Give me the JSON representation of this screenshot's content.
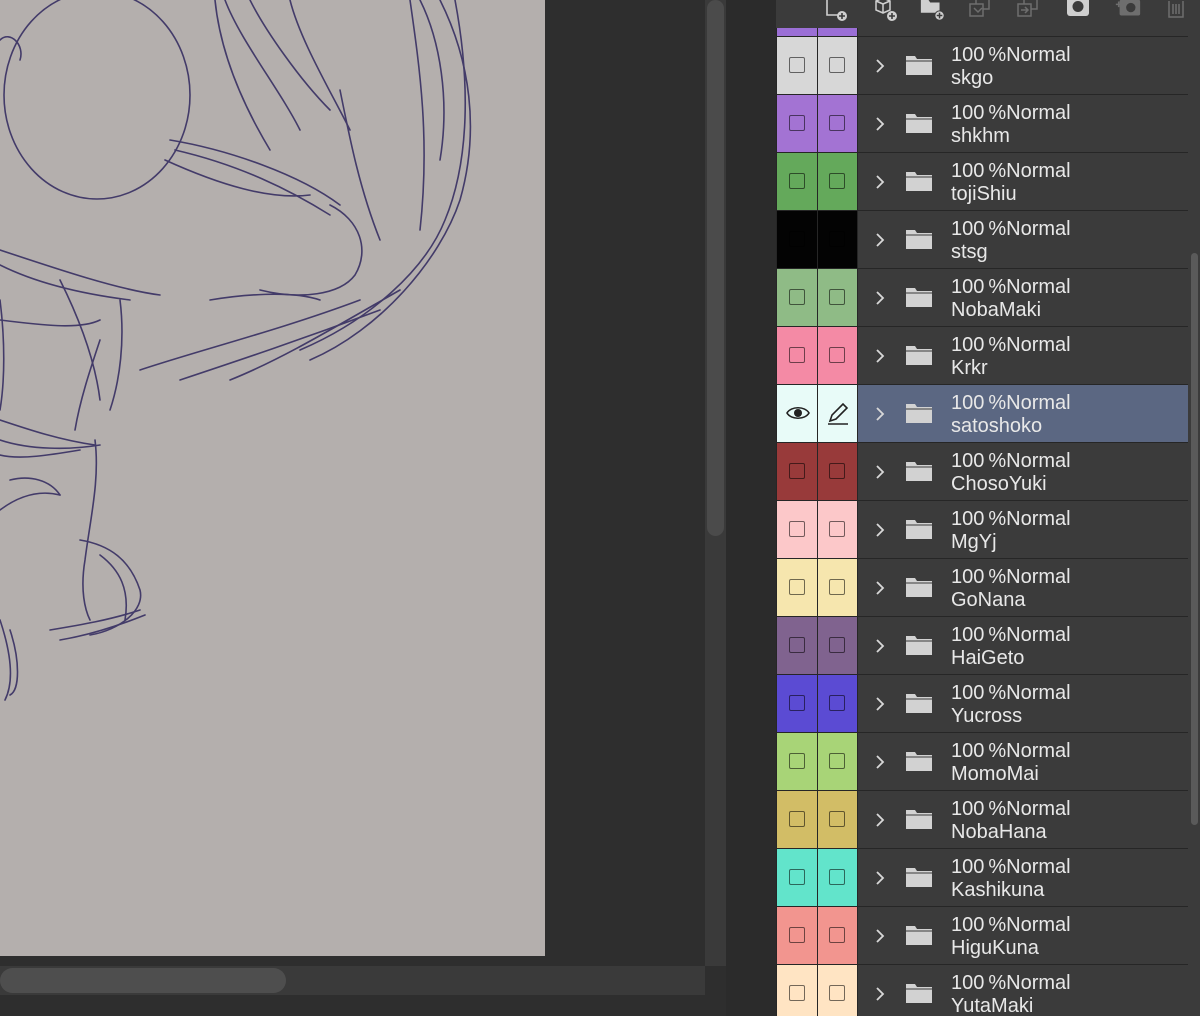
{
  "layer_panel": {
    "toolbar_icons": [
      "new-raster-layer-icon",
      "new-3d-layer-icon",
      "new-folder-icon",
      "transfer-to-lower-layer-icon",
      "combine-with-lower-layer-icon",
      "apply-mask-icon",
      "create-layer-mask-icon",
      "delete-layer-icon"
    ],
    "cut_top_color": "#9b6fd6",
    "layers": [
      {
        "opacity": "100",
        "unit": "%",
        "blend": "Normal",
        "name": "skgo",
        "color": "#d7d7d7",
        "selected": false
      },
      {
        "opacity": "100",
        "unit": "%",
        "blend": "Normal",
        "name": "shkhm",
        "color": "#a373d3",
        "selected": false
      },
      {
        "opacity": "100",
        "unit": "%",
        "blend": "Normal",
        "name": "tojiShiu",
        "color": "#64a95b",
        "selected": false
      },
      {
        "opacity": "100",
        "unit": "%",
        "blend": "Normal",
        "name": "stsg",
        "color": "#030303",
        "selected": false
      },
      {
        "opacity": "100",
        "unit": "%",
        "blend": "Normal",
        "name": "NobaMaki",
        "color": "#8fbb86",
        "selected": false
      },
      {
        "opacity": "100",
        "unit": "%",
        "blend": "Normal",
        "name": "Krkr",
        "color": "#f48aa5",
        "selected": false
      },
      {
        "opacity": "100",
        "unit": "%",
        "blend": "Normal",
        "name": "satoshoko",
        "color": "#e8fbf8",
        "selected": true
      },
      {
        "opacity": "100",
        "unit": "%",
        "blend": "Normal",
        "name": "ChosoYuki",
        "color": "#983a3a",
        "selected": false
      },
      {
        "opacity": "100",
        "unit": "%",
        "blend": "Normal",
        "name": "MgYj",
        "color": "#fcc8c9",
        "selected": false
      },
      {
        "opacity": "100",
        "unit": "%",
        "blend": "Normal",
        "name": "GoNana",
        "color": "#f6e6ae",
        "selected": false
      },
      {
        "opacity": "100",
        "unit": "%",
        "blend": "Normal",
        "name": "HaiGeto",
        "color": "#80638f",
        "selected": false
      },
      {
        "opacity": "100",
        "unit": "%",
        "blend": "Normal",
        "name": "Yucross",
        "color": "#5b4bd3",
        "selected": false
      },
      {
        "opacity": "100",
        "unit": "%",
        "blend": "Normal",
        "name": "MomoMai",
        "color": "#a8d477",
        "selected": false
      },
      {
        "opacity": "100",
        "unit": "%",
        "blend": "Normal",
        "name": "NobaHana",
        "color": "#d2bd66",
        "selected": false
      },
      {
        "opacity": "100",
        "unit": "%",
        "blend": "Normal",
        "name": "Kashikuna",
        "color": "#62e4cb",
        "selected": false
      },
      {
        "opacity": "100",
        "unit": "%",
        "blend": "Normal",
        "name": "HiguKuna",
        "color": "#f2958f",
        "selected": false
      },
      {
        "opacity": "100",
        "unit": "%",
        "blend": "Normal",
        "name": "YutaMaki",
        "color": "#ffe4c3",
        "selected": false
      }
    ]
  },
  "colors": {
    "panel_bg": "#3b3b3b",
    "selected_row": "#5b6782",
    "canvas_paper": "#b4afad",
    "sketch_stroke": "#3d3566"
  }
}
